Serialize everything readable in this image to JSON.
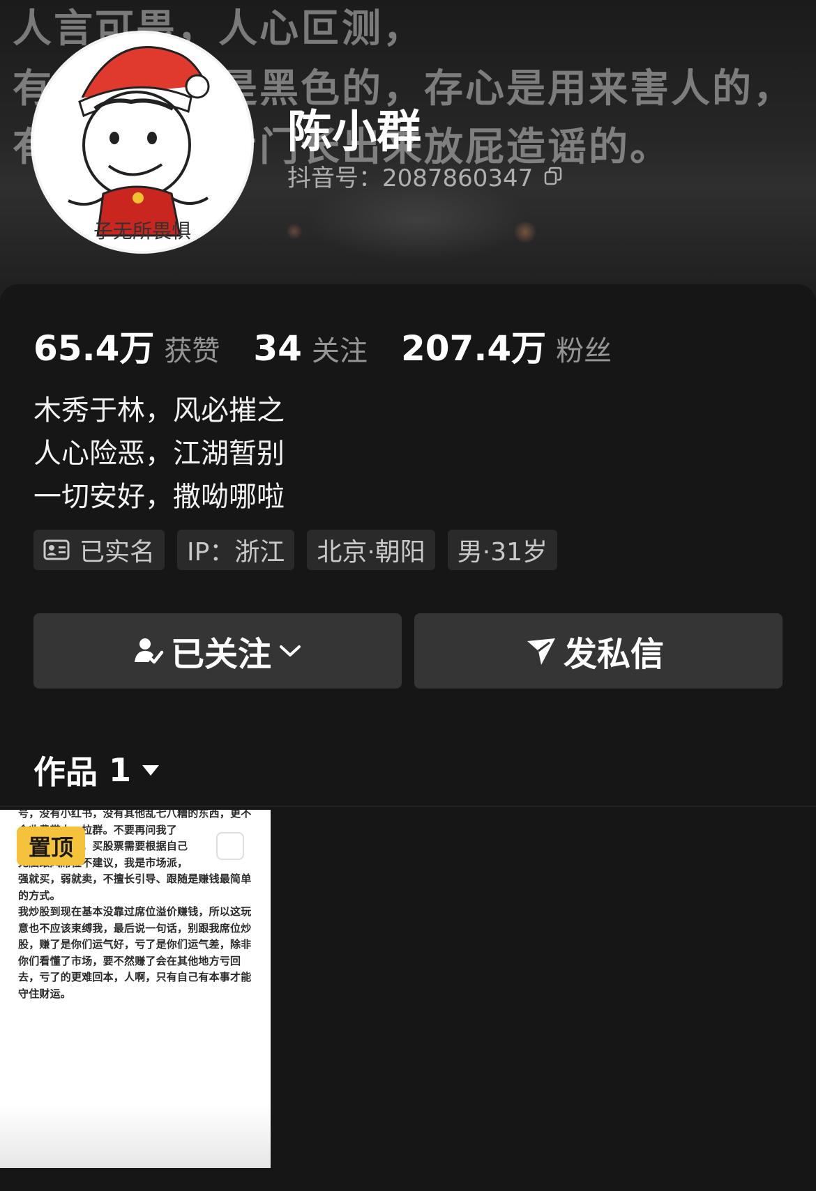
{
  "banner": {
    "lines": [
      "人言可畏，人心叵测，",
      "有些人的心是黑色的，存心是用来害人的，",
      "有些人的嘴专门长出来放屁造谣的。"
    ]
  },
  "profile": {
    "avatar_caption": "子无所畏惧",
    "name": "陈小群",
    "douyin_id": "抖音号：2087860347"
  },
  "stats": [
    {
      "value": "65.4万",
      "label": "获赞"
    },
    {
      "value": "34",
      "label": "关注"
    },
    {
      "value": "207.4万",
      "label": "粉丝"
    }
  ],
  "bio": [
    "木秀于林，风必摧之",
    "人心险恶，江湖暂别",
    "一切安好，撒呦哪啦"
  ],
  "tags": [
    {
      "label": "已实名",
      "icon": "id-card-icon"
    },
    {
      "label": "IP：浙江"
    },
    {
      "label": "北京·朝阳"
    },
    {
      "label": "男·31岁"
    }
  ],
  "buttons": {
    "follow": "已关注",
    "message": "发私信"
  },
  "works": {
    "label": "作品",
    "count": "1"
  },
  "thumbnail": {
    "badge": "置顶",
    "lines": [
      "号，没有小红书，没有其他乱七八糟的东西，更不",
      "会收费带人，拉群。不要再问我了",
      "跟风席位买入，买股票需要根据自己",
      "无脑跟风席位不建议，我是市场派，",
      "强就买，弱就卖，不擅长引导、跟随是赚钱最简单",
      "的方式。",
      "我炒股到现在基本没靠过席位溢价赚钱，所以这玩",
      "意也不应该束缚我，最后说一句话，别跟我席位炒",
      "股，赚了是你们运气好，亏了是你们运气差，除非",
      "你们看懂了市场，要不然赚了会在其他地方亏回",
      "去，亏了的更难回本，人啊，只有自己有本事才能",
      "守住财运。"
    ]
  }
}
